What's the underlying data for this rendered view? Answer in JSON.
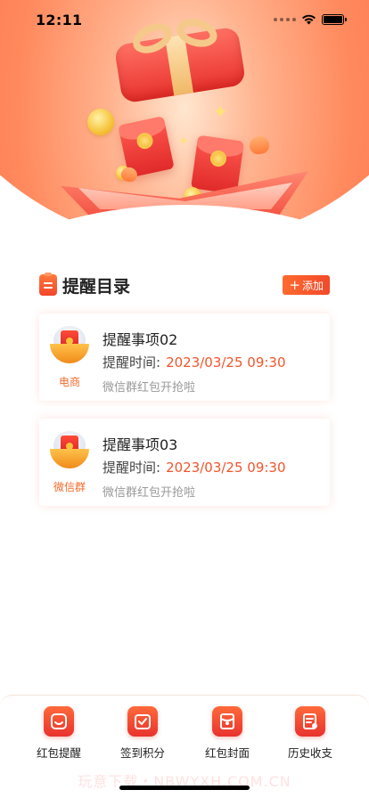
{
  "status_bar": {
    "time": "12:11"
  },
  "section": {
    "title": "提醒目录",
    "add_label": "添加"
  },
  "reminders": [
    {
      "category": "电商",
      "title": "提醒事项02",
      "time_label": "提醒时间:",
      "time_value": "2023/03/25 09:30",
      "description": "微信群红包开抢啦"
    },
    {
      "category": "微信群",
      "title": "提醒事项03",
      "time_label": "提醒时间:",
      "time_value": "2023/03/25 09:30",
      "description": "微信群红包开抢啦"
    }
  ],
  "tab_bar": {
    "items": [
      {
        "label": "红包提醒",
        "icon": "face-bag-icon"
      },
      {
        "label": "签到积分",
        "icon": "checkin-bag-icon"
      },
      {
        "label": "红包封面",
        "icon": "cover-icon"
      },
      {
        "label": "历史收支",
        "icon": "history-doc-icon"
      }
    ]
  },
  "watermark": "玩意下载・NBWYXH.COM.CN",
  "colors": {
    "accent": "#f2552c",
    "hero": "#ff6c46"
  }
}
